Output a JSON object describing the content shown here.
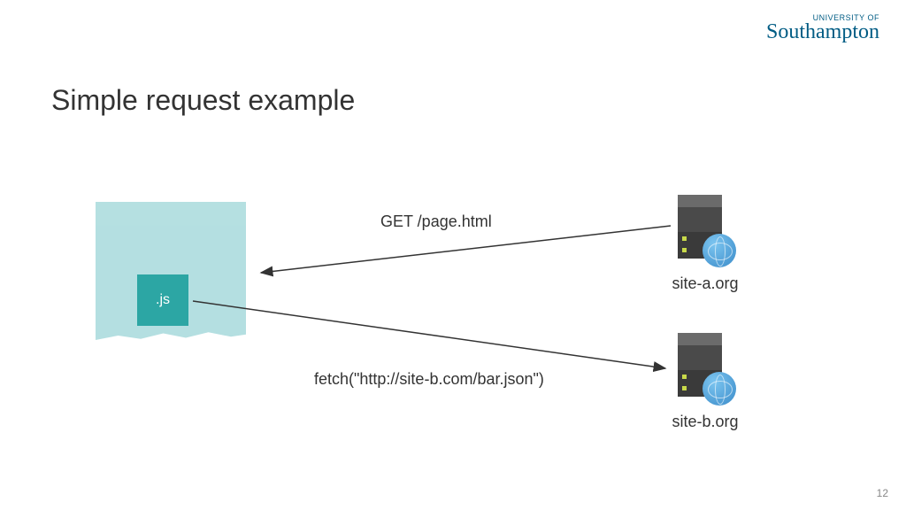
{
  "logo": {
    "small": "UNIVERSITY OF",
    "main": "Southampton"
  },
  "title": "Simple request example",
  "diagram": {
    "js_label": ".js",
    "request_label": "GET /page.html",
    "fetch_label": "fetch(\"http://site-b.com/bar.json\")",
    "server_a_label": "site-a.org",
    "server_b_label": "site-b.org"
  },
  "page_number": "12"
}
